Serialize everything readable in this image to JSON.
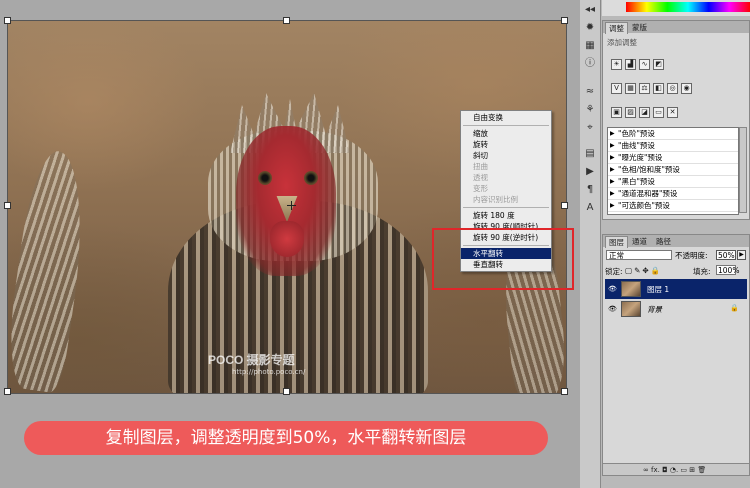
{
  "canvas": {
    "watermark_brand": "POCO 摄影专题",
    "watermark_url": "http://photo.poco.cn/"
  },
  "context_menu": {
    "items": [
      {
        "label": "自由变换",
        "disabled": false,
        "selected": false,
        "sep_after": true
      },
      {
        "label": "缩放",
        "disabled": false,
        "selected": false,
        "sep_after": false
      },
      {
        "label": "旋转",
        "disabled": false,
        "selected": false,
        "sep_after": false
      },
      {
        "label": "斜切",
        "disabled": false,
        "selected": false,
        "sep_after": false
      },
      {
        "label": "扭曲",
        "disabled": true,
        "selected": false,
        "sep_after": false
      },
      {
        "label": "透视",
        "disabled": true,
        "selected": false,
        "sep_after": false
      },
      {
        "label": "变形",
        "disabled": true,
        "selected": false,
        "sep_after": false
      },
      {
        "label": "内容识别比例",
        "disabled": true,
        "selected": false,
        "sep_after": true
      },
      {
        "label": "旋转 180 度",
        "disabled": false,
        "selected": false,
        "sep_after": false
      },
      {
        "label": "旋转 90 度(顺时针)",
        "disabled": false,
        "selected": false,
        "sep_after": false
      },
      {
        "label": "旋转 90 度(逆时针)",
        "disabled": false,
        "selected": false,
        "sep_after": true
      },
      {
        "label": "水平翻转",
        "disabled": false,
        "selected": true,
        "sep_after": false
      },
      {
        "label": "垂直翻转",
        "disabled": false,
        "selected": false,
        "sep_after": false
      }
    ]
  },
  "caption": "复制图层，调整透明度到50%，水平翻转新图层",
  "adjustments_panel": {
    "tabs": [
      "调整",
      "蒙版"
    ],
    "hint": "添加调整",
    "presets": [
      "\"色阶\"预设",
      "\"曲线\"预设",
      "\"曝光度\"预设",
      "\"色相/饱和度\"预设",
      "\"黑白\"预设",
      "\"通道混和器\"预设",
      "\"可选颜色\"预设"
    ]
  },
  "layers_panel": {
    "tabs": [
      "图层",
      "通道",
      "路径"
    ],
    "blend_mode": "正常",
    "opacity_label": "不透明度:",
    "opacity_value": "50%",
    "lock_label": "锁定:",
    "fill_label": "填充:",
    "fill_value": "100%",
    "layers": [
      {
        "name": "图层 1",
        "selected": true
      },
      {
        "name": "背景",
        "selected": false
      }
    ],
    "footer_icons": "∞  fx.  ◘  ◔.  ▭  ⊞  🗑"
  }
}
